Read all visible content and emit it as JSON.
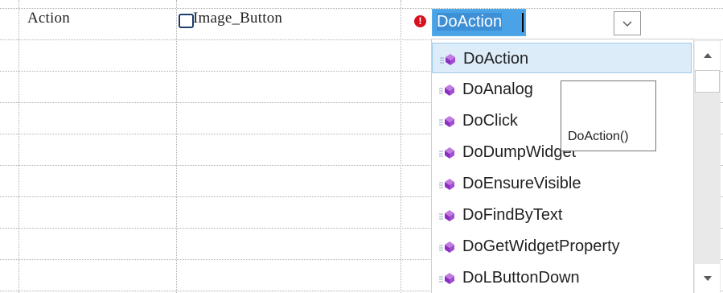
{
  "grid_row": {
    "col1_text": "Action",
    "col2_text": "Image_Button",
    "col3_value": "DoAction"
  },
  "icons": {
    "error": "error-icon",
    "checkbox": "checkbox-icon",
    "dropdown_arrow": "chevron-down-icon",
    "method": "method-icon",
    "scroll_up": "scroll-up-arrow-icon",
    "scroll_down": "scroll-down-arrow-icon"
  },
  "colors": {
    "selection_bg": "#4aa3e6",
    "list_selected_bg": "#dcecf8",
    "error_red": "#d8111e",
    "method_icon": "#a24bd3"
  },
  "dropdown": {
    "items": [
      {
        "label": "DoAction",
        "selected": true
      },
      {
        "label": "DoAnalog",
        "selected": false
      },
      {
        "label": "DoClick",
        "selected": false
      },
      {
        "label": "DoDumpWidget",
        "selected": false
      },
      {
        "label": "DoEnsureVisible",
        "selected": false
      },
      {
        "label": "DoFindByText",
        "selected": false
      },
      {
        "label": "DoGetWidgetProperty",
        "selected": false
      },
      {
        "label": "DoLButtonDown",
        "selected": false
      }
    ]
  },
  "tooltip": {
    "text": "DoAction()"
  }
}
